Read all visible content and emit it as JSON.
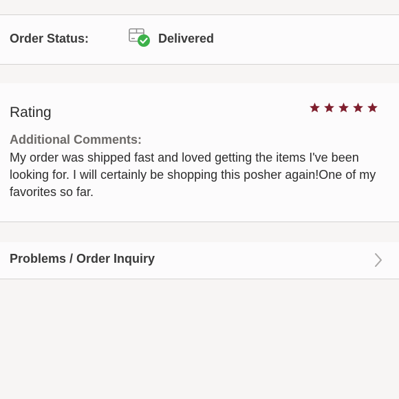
{
  "order_status": {
    "label": "Order Status:",
    "value": "Delivered",
    "icon": "box-check-icon",
    "status_color": "#3db14a"
  },
  "rating": {
    "title": "Rating",
    "stars": 5,
    "max_stars": 5,
    "star_color": "#7f1f2e",
    "comments_label": "Additional Comments:",
    "comments_text": "My order was shipped fast and loved getting the items I've been looking for. I will certainly be shopping this posher again!One of my favorites so far."
  },
  "inquiry": {
    "label": "Problems / Order Inquiry",
    "icon": "chevron-right-icon"
  }
}
